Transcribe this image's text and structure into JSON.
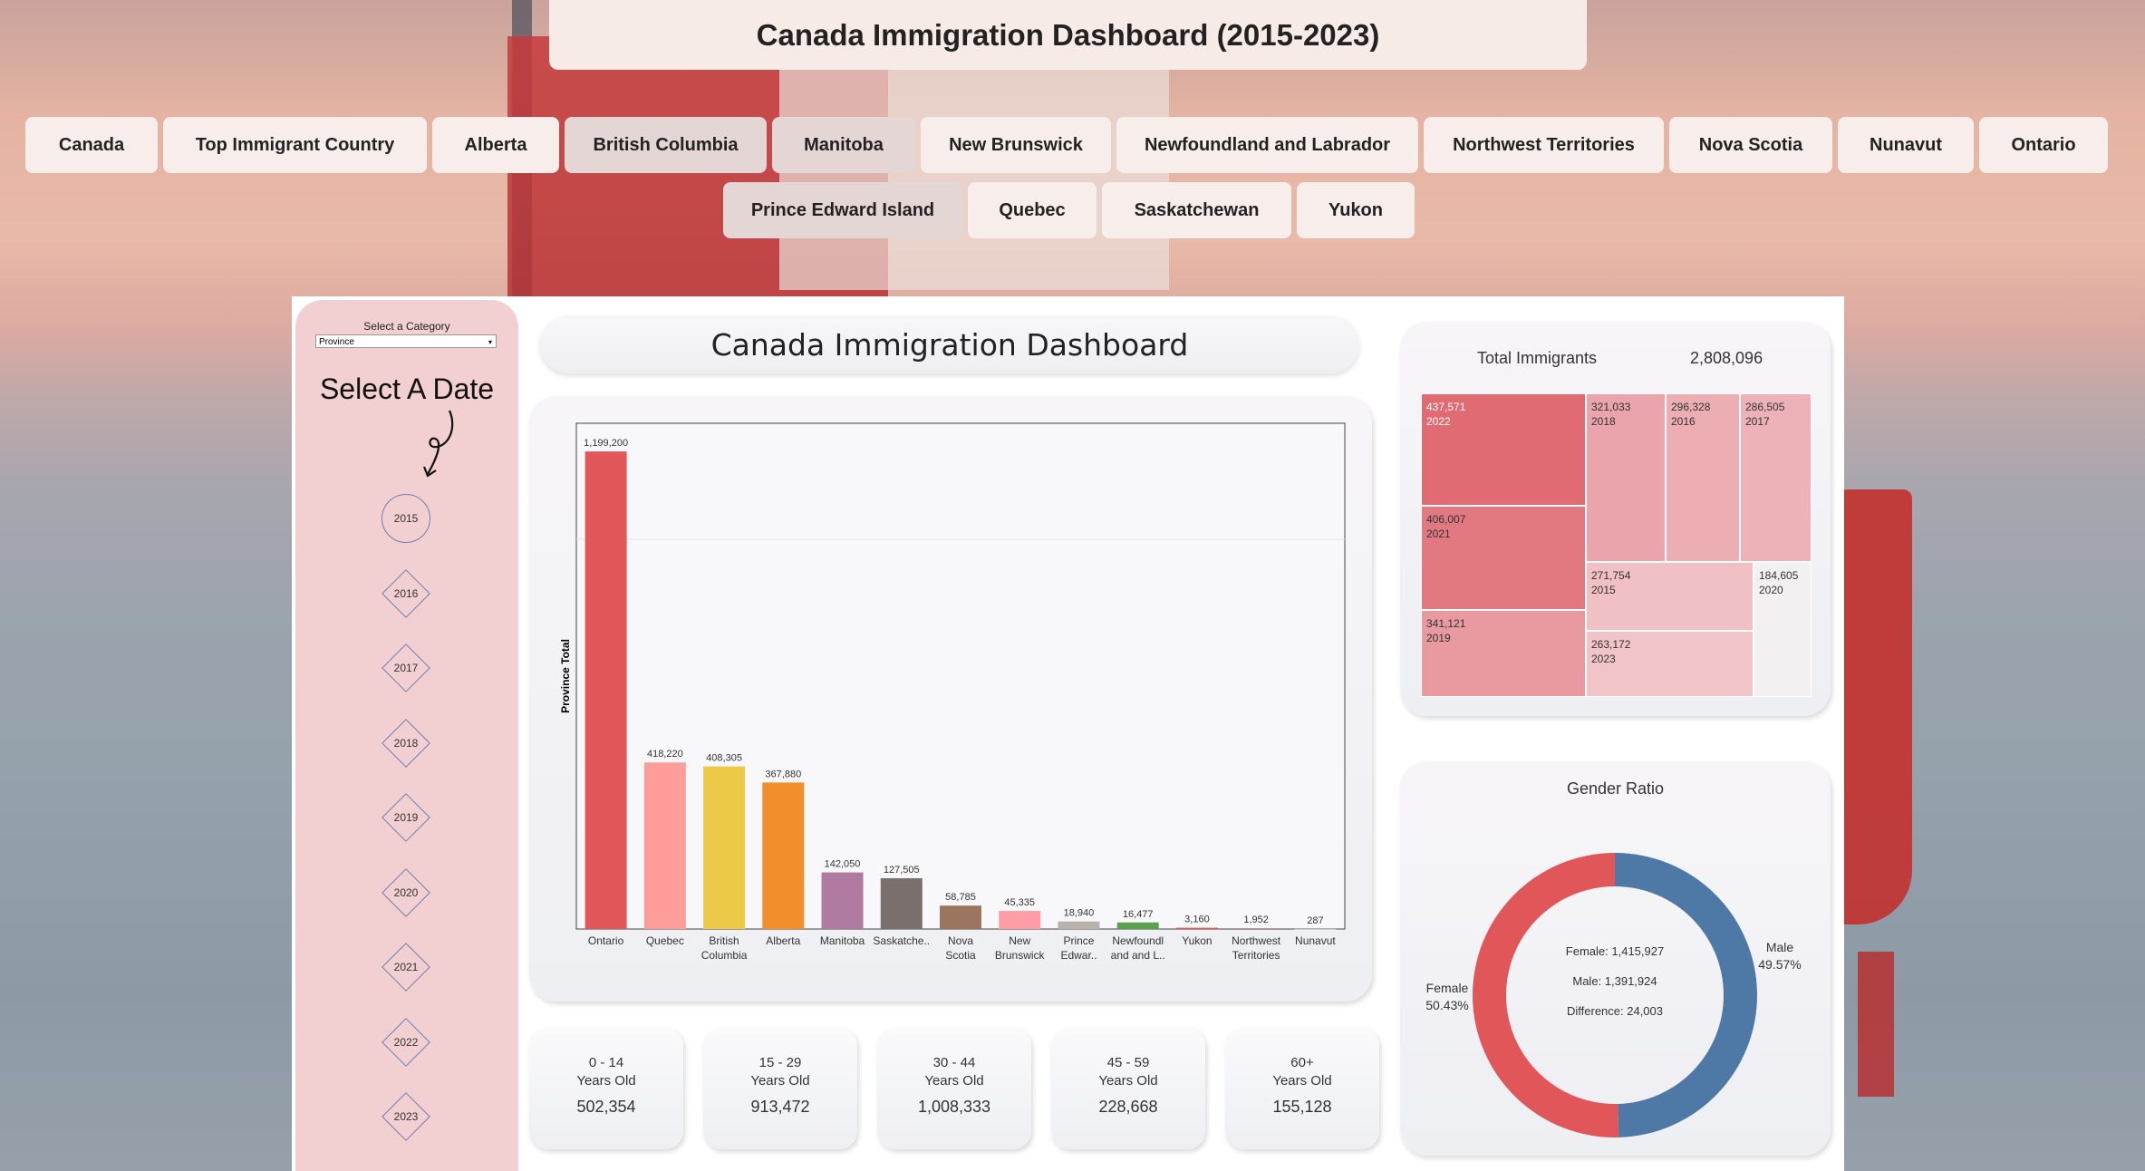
{
  "page_title": "Canada Immigration Dashboard (2015-2023)",
  "nav_row1": [
    {
      "label": "Canada",
      "w": 146
    },
    {
      "label": "Top Immigrant Country",
      "w": 291
    },
    {
      "label": "Alberta",
      "w": 140
    },
    {
      "label": "British Columbia",
      "w": 223
    },
    {
      "label": "Manitoba",
      "w": 158
    },
    {
      "label": "New Brunswick",
      "w": 210
    },
    {
      "label": "Newfoundland and Labrador",
      "w": 333
    },
    {
      "label": "Northwest Territories",
      "w": 265
    },
    {
      "label": "Nova Scotia",
      "w": 180
    },
    {
      "label": "Nunavut",
      "w": 150
    },
    {
      "label": "Ontario",
      "w": 142
    }
  ],
  "nav_row2": [
    {
      "label": "Prince Edward Island",
      "w": 264
    },
    {
      "label": "Quebec",
      "w": 142
    },
    {
      "label": "Saskatchewan",
      "w": 209
    },
    {
      "label": "Yukon",
      "w": 130
    }
  ],
  "sidebar": {
    "select_label": "Select a Category",
    "select_value": "Province",
    "date_heading": "Select A Date",
    "years": [
      "2015",
      "2016",
      "2017",
      "2018",
      "2019",
      "2020",
      "2021",
      "2022",
      "2023"
    ]
  },
  "dashboard_title": "Canada Immigration Dashboard",
  "chart_data": {
    "type": "bar",
    "ylabel": "Province Total",
    "categories": [
      [
        "Ontario"
      ],
      [
        "Quebec"
      ],
      [
        "British",
        "Columbia"
      ],
      [
        "Alberta"
      ],
      [
        "Manitoba"
      ],
      [
        "Saskatche.."
      ],
      [
        "Nova",
        "Scotia"
      ],
      [
        "New",
        "Brunswick"
      ],
      [
        "Prince",
        "Edwar.."
      ],
      [
        "Newfoundl",
        "and and L.."
      ],
      [
        "Yukon"
      ],
      [
        "Northwest",
        "Territories"
      ],
      [
        "Nunavut"
      ]
    ],
    "values": [
      1199200,
      418220,
      408305,
      367880,
      142050,
      127505,
      58785,
      45335,
      18940,
      16477,
      3160,
      1952,
      287
    ],
    "value_labels": [
      "1,199,200",
      "418,220",
      "408,305",
      "367,880",
      "142,050",
      "127,505",
      "58,785",
      "45,335",
      "18,940",
      "16,477",
      "3,160",
      "1,952",
      "287"
    ],
    "colors": [
      "#e15759",
      "#ff9d9a",
      "#edc948",
      "#f28e2b",
      "#b07aa1",
      "#79706e",
      "#9c755f",
      "#ff9da7",
      "#bab0ac",
      "#59a14f",
      "#e15759",
      "#b07aa1",
      "#cccccc"
    ]
  },
  "age_groups": [
    {
      "range": "0 - 14",
      "unit": "Years Old",
      "value": "502,354"
    },
    {
      "range": "15 - 29",
      "unit": "Years Old",
      "value": "913,472"
    },
    {
      "range": "30 - 44",
      "unit": "Years Old",
      "value": "1,008,333"
    },
    {
      "range": "45 - 59",
      "unit": "Years Old",
      "value": "228,668"
    },
    {
      "range": "60+",
      "unit": "Years Old",
      "value": "155,128"
    }
  ],
  "treemap": {
    "label": "Total Immigrants",
    "total": "2,808,096",
    "cells": [
      {
        "value": "437,571",
        "year": "2022",
        "color": "#e06b72",
        "text": "#ffffff"
      },
      {
        "value": "406,007",
        "year": "2021",
        "color": "#e27980",
        "text": "#333333"
      },
      {
        "value": "341,121",
        "year": "2019",
        "color": "#e89aa0",
        "text": "#333333"
      },
      {
        "value": "321,033",
        "year": "2018",
        "color": "#eaa4ab",
        "text": "#333333"
      },
      {
        "value": "296,328",
        "year": "2016",
        "color": "#ecadb3",
        "text": "#333333"
      },
      {
        "value": "286,505",
        "year": "2017",
        "color": "#edb2b8",
        "text": "#333333"
      },
      {
        "value": "271,754",
        "year": "2015",
        "color": "#f0c0c4",
        "text": "#333333"
      },
      {
        "value": "263,172",
        "year": "2023",
        "color": "#f1c4c8",
        "text": "#333333"
      },
      {
        "value": "184,605",
        "year": "2020",
        "color": "#f2f0f0",
        "text": "#333333"
      }
    ]
  },
  "gender": {
    "title": "Gender Ratio",
    "female_label": "Female",
    "female_pct": "50.43%",
    "male_label": "Male",
    "male_pct": "49.57%",
    "female_share": 0.5043,
    "female_color": "#e15759",
    "male_color": "#4e79a7",
    "center_female": "Female: 1,415,927",
    "center_male": "Male: 1,391,924",
    "center_diff": "Difference: 24,003"
  }
}
